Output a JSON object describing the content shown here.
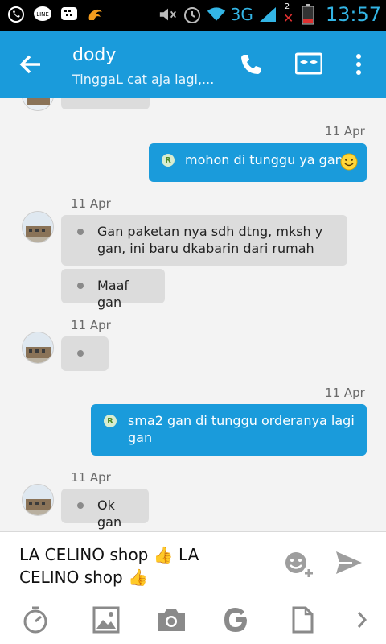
{
  "status_bar": {
    "icons": [
      "whatsapp-icon",
      "line-icon",
      "bbm-icon",
      "uc-browser-icon",
      "mute-icon",
      "alarm-icon",
      "wifi-icon",
      "signal-icon",
      "battery-icon"
    ],
    "network": "3G",
    "sim_indicator": "2",
    "time": "13:57",
    "accent_color": "#33b5e5"
  },
  "header": {
    "title": "dody",
    "subtitle": "TinggaL cat aja lagi,...",
    "color": "#1a9bdb"
  },
  "messages": [
    {
      "direction": "out",
      "time": "11 Apr",
      "text": "mohon di tunggu ya gan",
      "badge": "R"
    },
    {
      "direction": "in",
      "time": "11 Apr",
      "text": "Gan paketan nya sdh dtng, mksh y gan, ini baru dkabarin dari rumah"
    },
    {
      "direction": "in",
      "time": "",
      "text": "Maaf gan"
    },
    {
      "direction": "in",
      "time": "11 Apr",
      "text": ""
    },
    {
      "direction": "out",
      "time": "11 Apr",
      "text": "sma2 gan di tunggu orderanya lagi gan",
      "badge": "R"
    },
    {
      "direction": "in",
      "time": "11 Apr",
      "text": "Ok gan"
    }
  ],
  "compose": {
    "text": "LA CELINO shop 👍 LA CELINO shop 👍"
  },
  "toolbar": {
    "icons": [
      "timer-icon",
      "image-icon",
      "camera-icon",
      "google-icon",
      "document-icon",
      "chevron-right-icon"
    ]
  }
}
